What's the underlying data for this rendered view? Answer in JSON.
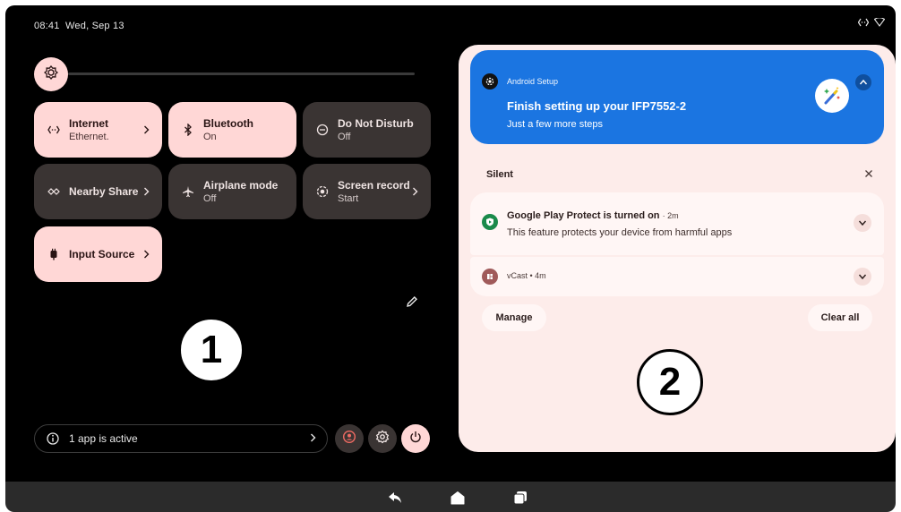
{
  "status_bar": {
    "time": "08:41",
    "date": "Wed, Sep 13",
    "icons": [
      "ethernet-icon",
      "wifi-icon"
    ]
  },
  "brightness": {
    "icon": "brightness-icon",
    "level": 0.0
  },
  "tiles": [
    {
      "label": "Internet",
      "subtitle": "Ethernet.",
      "icon": "ethernet-icon",
      "state": "on",
      "has_chevron": true
    },
    {
      "label": "Bluetooth",
      "subtitle": "On",
      "icon": "bluetooth-icon",
      "state": "on",
      "has_chevron": false
    },
    {
      "label": "Do Not Disturb",
      "subtitle": "Off",
      "icon": "do-not-disturb-icon",
      "state": "off",
      "has_chevron": false
    },
    {
      "label": "Nearby Share",
      "subtitle": "",
      "icon": "nearby-share-icon",
      "state": "off",
      "has_chevron": true
    },
    {
      "label": "Airplane mode",
      "subtitle": "Off",
      "icon": "airplane-icon",
      "state": "off",
      "has_chevron": false
    },
    {
      "label": "Screen record",
      "subtitle": "Start",
      "icon": "screen-record-icon",
      "state": "off",
      "has_chevron": true
    },
    {
      "label": "Input Source",
      "subtitle": "",
      "icon": "input-source-icon",
      "state": "on",
      "has_chevron": true
    }
  ],
  "footer": {
    "active_apps": "1 app is active",
    "buttons": [
      "user-icon",
      "settings-icon",
      "power-icon"
    ]
  },
  "badges": {
    "left": "1",
    "right": "2"
  },
  "notifications": {
    "setup": {
      "app": "Android Setup",
      "title": "Finish setting up your IFP7552-2",
      "message": "Just a few more steps"
    },
    "section_label": "Silent",
    "items": [
      {
        "title": "Google Play Protect is turned on",
        "time": "2m",
        "text": "This feature protects your device from harmful apps"
      },
      {
        "title": "vCast",
        "time": "4m",
        "text": ""
      }
    ],
    "manage_label": "Manage",
    "clear_all_label": "Clear all"
  },
  "nav": [
    "back-icon",
    "home-icon",
    "recents-icon"
  ],
  "colors": {
    "tile_on": "#ffd7d6",
    "tile_off": "#3a3433",
    "setup_blue": "#1b75e1",
    "panel_bg": "#fdecea"
  }
}
